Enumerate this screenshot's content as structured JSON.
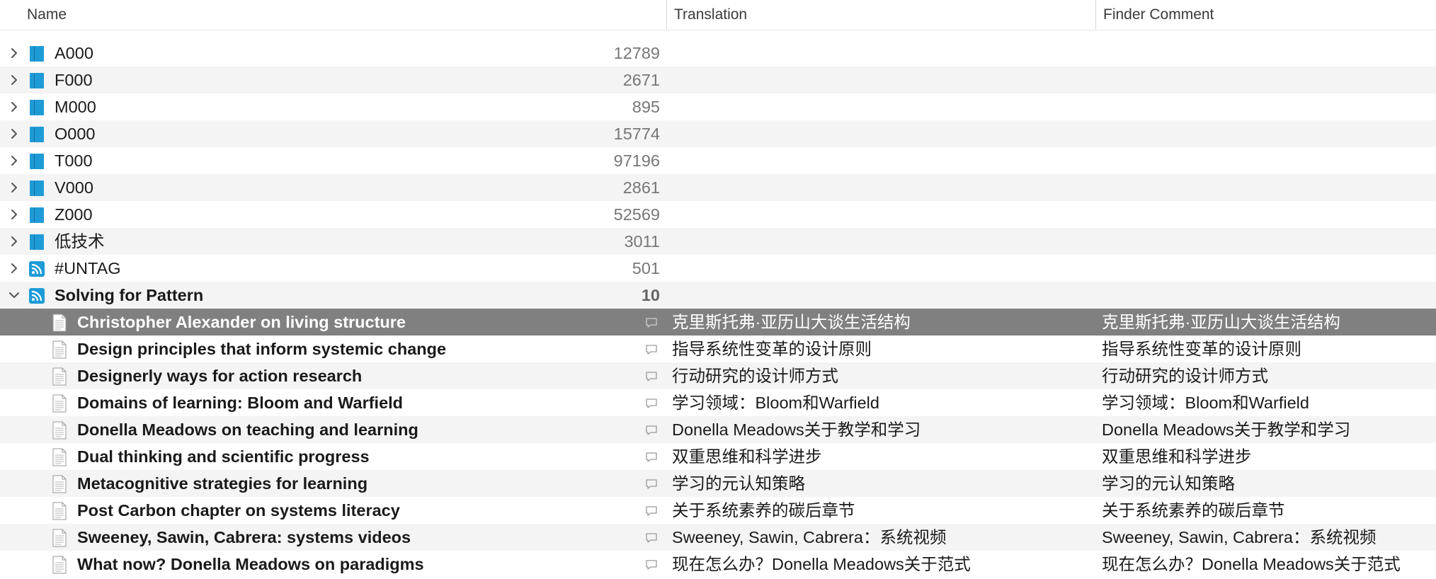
{
  "columns": {
    "name": "Name",
    "translation": "Translation",
    "finder_comment": "Finder Comment"
  },
  "colors": {
    "group_icon": "#1E9BD7",
    "selected_row": "#808080",
    "alt_row": "#F4F4F4"
  },
  "groups": [
    {
      "name": "A000",
      "count": "12789",
      "icon": "book-icon",
      "expanded": false
    },
    {
      "name": "F000",
      "count": "2671",
      "icon": "book-icon",
      "expanded": false
    },
    {
      "name": "M000",
      "count": "895",
      "icon": "book-icon",
      "expanded": false
    },
    {
      "name": "O000",
      "count": "15774",
      "icon": "book-icon",
      "expanded": false
    },
    {
      "name": "T000",
      "count": "97196",
      "icon": "book-icon",
      "expanded": false
    },
    {
      "name": "V000",
      "count": "2861",
      "icon": "book-icon",
      "expanded": false
    },
    {
      "name": "Z000",
      "count": "52569",
      "icon": "book-icon",
      "expanded": false
    },
    {
      "name": "低技术",
      "count": "3011",
      "icon": "book-icon",
      "expanded": false
    },
    {
      "name": "#UNTAG",
      "count": "501",
      "icon": "rss-icon",
      "expanded": false
    },
    {
      "name": "Solving for Pattern",
      "count": "10",
      "icon": "rss-icon",
      "expanded": true
    }
  ],
  "documents": [
    {
      "name": "Christopher Alexander on living structure",
      "translation": "克里斯托弗·亚历山大谈生活结构",
      "comment": "克里斯托弗·亚历山大谈生活结构",
      "selected": true
    },
    {
      "name": "Design principles that inform systemic change",
      "translation": "指导系统性变革的设计原则",
      "comment": "指导系统性变革的设计原则"
    },
    {
      "name": "Designerly ways for action research",
      "translation": "行动研究的设计师方式",
      "comment": "行动研究的设计师方式"
    },
    {
      "name": "Domains of learning: Bloom and Warfield",
      "translation": "学习领域：Bloom和Warfield",
      "comment": "学习领域：Bloom和Warfield"
    },
    {
      "name": "Donella Meadows on teaching and learning",
      "translation": "Donella Meadows关于教学和学习",
      "comment": "Donella Meadows关于教学和学习"
    },
    {
      "name": "Dual thinking and scientific progress",
      "translation": "双重思维和科学进步",
      "comment": "双重思维和科学进步"
    },
    {
      "name": "Metacognitive strategies for learning",
      "translation": "学习的元认知策略",
      "comment": "学习的元认知策略"
    },
    {
      "name": "Post Carbon chapter on systems literacy",
      "translation": "关于系统素养的碳后章节",
      "comment": "关于系统素养的碳后章节"
    },
    {
      "name": "Sweeney, Sawin, Cabrera: systems videos",
      "translation": "Sweeney, Sawin, Cabrera：系统视频",
      "comment": "Sweeney, Sawin, Cabrera：系统视频"
    },
    {
      "name": "What now? Donella Meadows on paradigms",
      "translation": "现在怎么办？Donella Meadows关于范式",
      "comment": "现在怎么办？Donella Meadows关于范式"
    }
  ]
}
